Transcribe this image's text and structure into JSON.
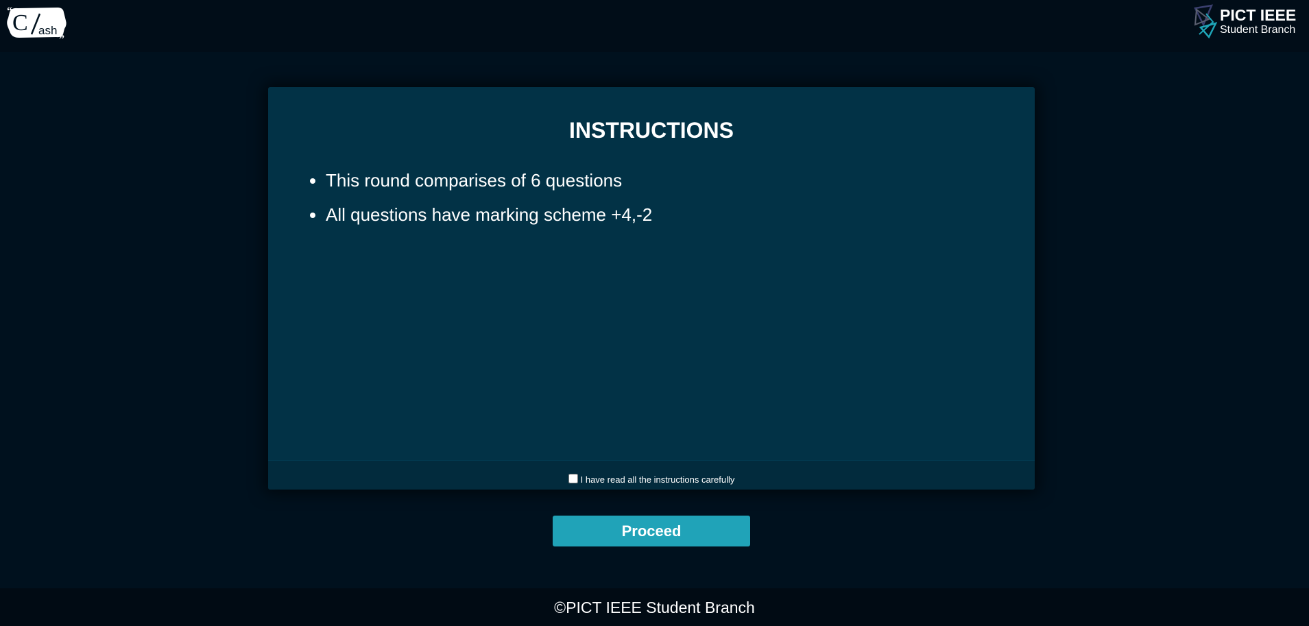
{
  "header": {
    "logo_left_icon": "clash-logo-icon",
    "logo_left_text_big": "C",
    "logo_left_text_small": "ash",
    "logo_right_icon": "ieee-logo-icon",
    "logo_right_name": "PICT IEEE",
    "logo_right_sub": "Student Branch"
  },
  "card": {
    "title": "INSTRUCTIONS",
    "rules": [
      "This round comparises of 6 questions",
      "All questions have marking scheme +4,-2"
    ],
    "agree_checked": false,
    "agree_label": "I have read all the instructions carefully"
  },
  "actions": {
    "proceed_label": "Proceed"
  },
  "footer": {
    "copyright": "©PICT IEEE Student Branch"
  },
  "colors": {
    "page_bg": "#00111e",
    "card_bg": "#023246",
    "button_bg": "#20a3b8",
    "ieee_accent": "#1fa6b8"
  }
}
